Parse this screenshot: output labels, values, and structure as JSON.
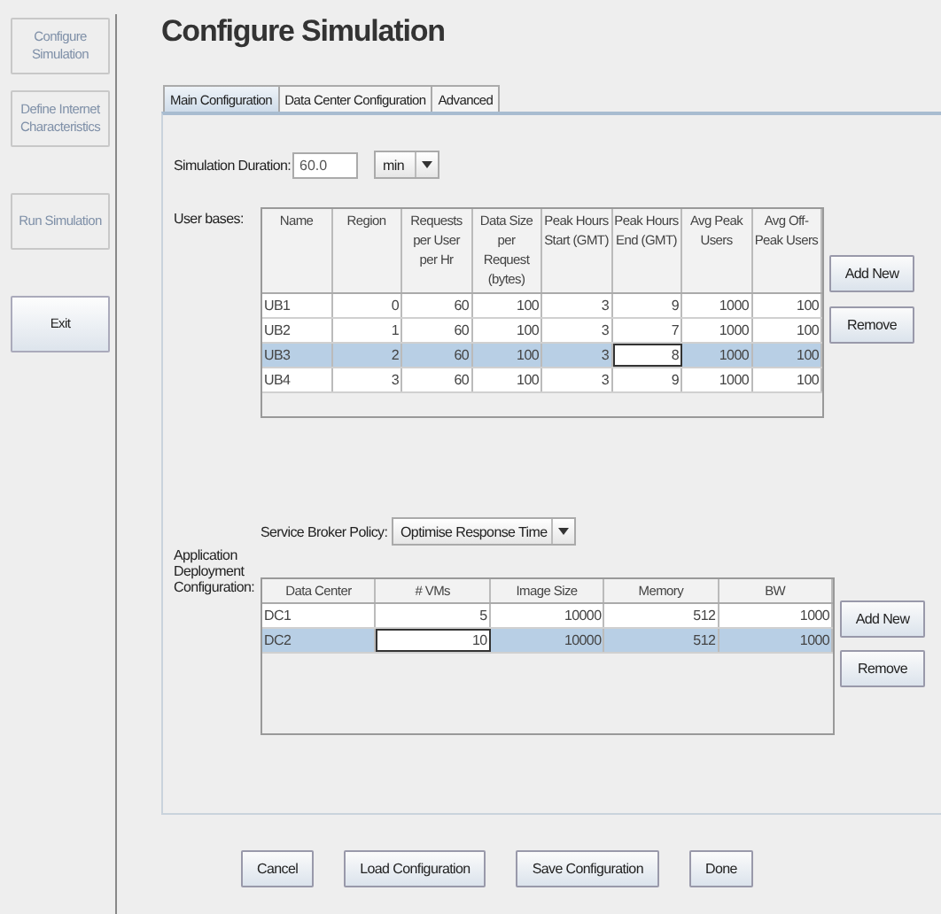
{
  "sidebar": {
    "items": [
      {
        "label": "Configure Simulation",
        "disabled": true
      },
      {
        "label": "Define Internet Characteristics",
        "disabled": true
      },
      {
        "label": "Run Simulation",
        "disabled": true
      },
      {
        "label": "Exit",
        "disabled": false
      }
    ]
  },
  "title": "Configure Simulation",
  "tabs": [
    {
      "label": "Main Configuration",
      "selected": true
    },
    {
      "label": "Data Center Configuration",
      "selected": false
    },
    {
      "label": "Advanced",
      "selected": false
    }
  ],
  "simulation_duration": {
    "label": "Simulation Duration:",
    "value": "60.0",
    "unit": "min"
  },
  "user_bases": {
    "label": "User bases:",
    "columns": [
      "Name",
      "Region",
      "Requests per User per Hr",
      "Data Size per Request (bytes)",
      "Peak Hours Start (GMT)",
      "Peak Hours End (GMT)",
      "Avg Peak Users",
      "Avg Off-Peak Users"
    ],
    "rows": [
      {
        "selected": false,
        "cells": [
          {
            "text": "UB1",
            "editing": false
          },
          {
            "text": "0",
            "editing": false
          },
          {
            "text": "60",
            "editing": false
          },
          {
            "text": "100",
            "editing": false
          },
          {
            "text": "3",
            "editing": false
          },
          {
            "text": "9",
            "editing": false
          },
          {
            "text": "1000",
            "editing": false
          },
          {
            "text": "100",
            "editing": false
          }
        ]
      },
      {
        "selected": false,
        "cells": [
          {
            "text": "UB2",
            "editing": false
          },
          {
            "text": "1",
            "editing": false
          },
          {
            "text": "60",
            "editing": false
          },
          {
            "text": "100",
            "editing": false
          },
          {
            "text": "3",
            "editing": false
          },
          {
            "text": "7",
            "editing": false
          },
          {
            "text": "1000",
            "editing": false
          },
          {
            "text": "100",
            "editing": false
          }
        ]
      },
      {
        "selected": true,
        "cells": [
          {
            "text": "UB3",
            "editing": false
          },
          {
            "text": "2",
            "editing": false
          },
          {
            "text": "60",
            "editing": false
          },
          {
            "text": "100",
            "editing": false
          },
          {
            "text": "3",
            "editing": false
          },
          {
            "text": "8",
            "editing": true
          },
          {
            "text": "1000",
            "editing": false
          },
          {
            "text": "100",
            "editing": false
          }
        ]
      },
      {
        "selected": false,
        "cells": [
          {
            "text": "UB4",
            "editing": false
          },
          {
            "text": "3",
            "editing": false
          },
          {
            "text": "60",
            "editing": false
          },
          {
            "text": "100",
            "editing": false
          },
          {
            "text": "3",
            "editing": false
          },
          {
            "text": "9",
            "editing": false
          },
          {
            "text": "1000",
            "editing": false
          },
          {
            "text": "100",
            "editing": false
          }
        ]
      }
    ],
    "buttons": [
      "Add New",
      "Remove"
    ]
  },
  "deployment": {
    "label": "Application Deployment Configuration:",
    "policy_label": "Service Broker Policy:",
    "policy": "Optimise Response Time",
    "columns": [
      "Data Center",
      "# VMs",
      "Image Size",
      "Memory",
      "BW"
    ],
    "rows": [
      {
        "selected": false,
        "cells": [
          {
            "text": "DC1",
            "editing": false
          },
          {
            "text": "5",
            "editing": false
          },
          {
            "text": "10000",
            "editing": false
          },
          {
            "text": "512",
            "editing": false
          },
          {
            "text": "1000",
            "editing": false
          }
        ]
      },
      {
        "selected": true,
        "cells": [
          {
            "text": "DC2",
            "editing": false
          },
          {
            "text": "10",
            "editing": true
          },
          {
            "text": "10000",
            "editing": false
          },
          {
            "text": "512",
            "editing": false
          },
          {
            "text": "1000",
            "editing": false
          }
        ]
      }
    ],
    "buttons": [
      "Add New",
      "Remove"
    ]
  },
  "footer_buttons": [
    "Cancel",
    "Load Configuration",
    "Save Configuration",
    "Done"
  ]
}
